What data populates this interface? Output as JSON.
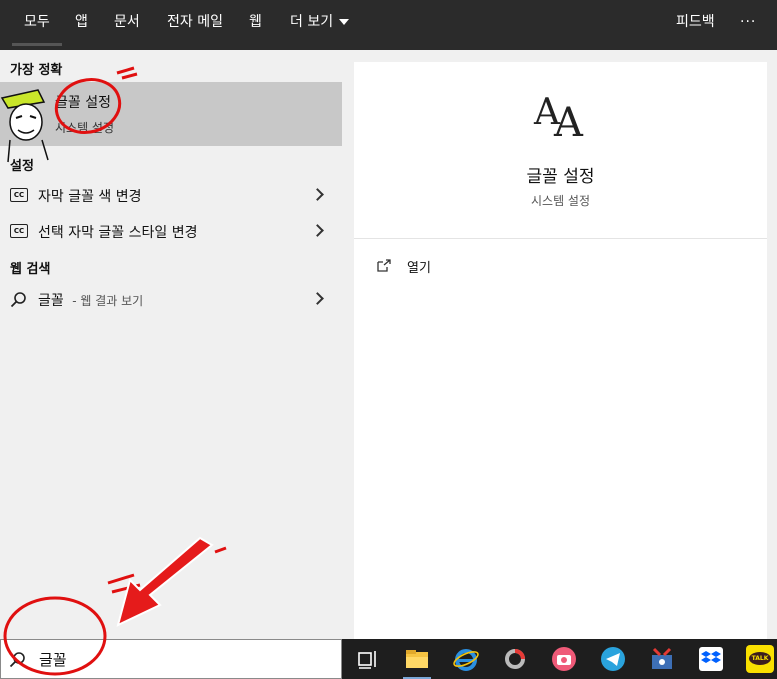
{
  "topbar": {
    "tabs": [
      "모두",
      "앱",
      "문서",
      "전자 메일",
      "웹",
      "더 보기"
    ],
    "feedback": "피드백",
    "more": "···"
  },
  "left": {
    "best_match_header": "가장 정확",
    "best_match": {
      "title": "글꼴 설정",
      "subtitle": "시스템 설정"
    },
    "settings_header": "설정",
    "settings_items": [
      "자막 글꼴 색 변경",
      "선택 자막 글꼴 스타일 변경"
    ],
    "web_header": "웹 검색",
    "web_item": {
      "label": "글꼴",
      "suffix": "- 웹 결과 보기"
    }
  },
  "detail": {
    "title": "글꼴 설정",
    "subtitle": "시스템 설정",
    "action": "열기"
  },
  "search": {
    "value": "글꼴"
  },
  "taskbar": {
    "kakao": "TALK"
  },
  "icons": {
    "cc": "caption-icon",
    "search": "search-icon",
    "font": "font-icon",
    "open": "open-icon",
    "task_view": "task-view-icon"
  }
}
